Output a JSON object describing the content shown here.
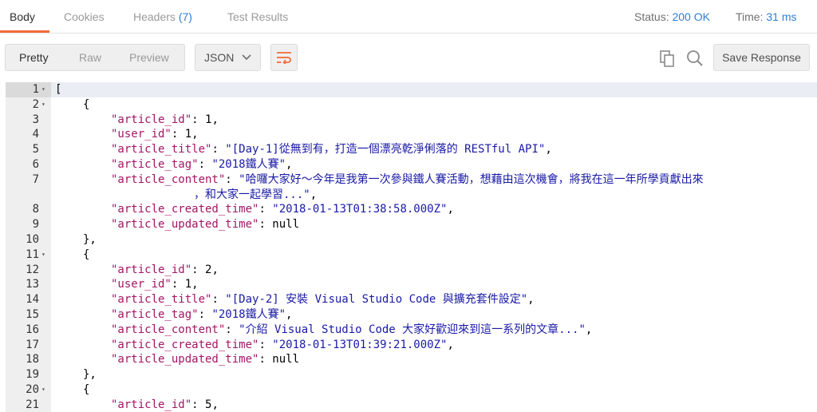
{
  "tabs": [
    {
      "label": "Body",
      "active": true
    },
    {
      "label": "Cookies"
    },
    {
      "label": "Headers",
      "count": "(7)"
    },
    {
      "label": "Test Results"
    }
  ],
  "status": {
    "status_label": "Status:",
    "status_value": "200 OK",
    "time_label": "Time:",
    "time_value": "31 ms"
  },
  "view_modes": [
    "Pretty",
    "Raw",
    "Preview"
  ],
  "format": "JSON",
  "save_label": "Save Response",
  "icons": {
    "wrap": "wrap-lines-icon",
    "copy": "copy-icon",
    "search": "search-icon",
    "chevron": "chevron-down-icon"
  },
  "colors": {
    "accent": "#f26b3a",
    "link": "#2d7ed9",
    "key": "#a31566",
    "string": "#1a1aa6"
  },
  "code_lines": [
    {
      "n": "1",
      "fold": true,
      "indent": 0,
      "p": "["
    },
    {
      "n": "2",
      "fold": true,
      "indent": 1,
      "p": "{"
    },
    {
      "n": "3",
      "indent": 2,
      "k": "\"article_id\"",
      "p": ": ",
      "v": "1",
      "e": ","
    },
    {
      "n": "4",
      "indent": 2,
      "k": "\"user_id\"",
      "p": ": ",
      "v": "1",
      "e": ","
    },
    {
      "n": "5",
      "indent": 2,
      "k": "\"article_title\"",
      "p": ": ",
      "s": "\"[Day-1]從無到有，打造一個漂亮乾淨俐落的 RESTful API\"",
      "e": ","
    },
    {
      "n": "6",
      "indent": 2,
      "k": "\"article_tag\"",
      "p": ": ",
      "s": "\"2018鐵人賽\"",
      "e": ","
    },
    {
      "n": "7",
      "indent": 2,
      "k": "\"article_content\"",
      "p": ": ",
      "s": "\"哈囉大家好～今年是我第一次參與鐵人賽活動，想藉由這次機會，將我在這一年所學貢獻出來",
      "s2": "，和大家一起學習...\"",
      "e": ","
    },
    {
      "n": "8",
      "indent": 2,
      "k": "\"article_created_time\"",
      "p": ": ",
      "s": "\"2018-01-13T01:38:58.000Z\"",
      "e": ","
    },
    {
      "n": "9",
      "indent": 2,
      "k": "\"article_updated_time\"",
      "p": ": ",
      "v": "null"
    },
    {
      "n": "10",
      "indent": 1,
      "p": "},"
    },
    {
      "n": "11",
      "fold": true,
      "indent": 1,
      "p": "{"
    },
    {
      "n": "12",
      "indent": 2,
      "k": "\"article_id\"",
      "p": ": ",
      "v": "2",
      "e": ","
    },
    {
      "n": "13",
      "indent": 2,
      "k": "\"user_id\"",
      "p": ": ",
      "v": "1",
      "e": ","
    },
    {
      "n": "14",
      "indent": 2,
      "k": "\"article_title\"",
      "p": ": ",
      "s": "\"[Day-2] 安裝 Visual Studio Code 與擴充套件設定\"",
      "e": ","
    },
    {
      "n": "15",
      "indent": 2,
      "k": "\"article_tag\"",
      "p": ": ",
      "s": "\"2018鐵人賽\"",
      "e": ","
    },
    {
      "n": "16",
      "indent": 2,
      "k": "\"article_content\"",
      "p": ": ",
      "s": "\"介紹 Visual Studio Code 大家好歡迎來到這一系列的文章...\"",
      "e": ","
    },
    {
      "n": "17",
      "indent": 2,
      "k": "\"article_created_time\"",
      "p": ": ",
      "s": "\"2018-01-13T01:39:21.000Z\"",
      "e": ","
    },
    {
      "n": "18",
      "indent": 2,
      "k": "\"article_updated_time\"",
      "p": ": ",
      "v": "null"
    },
    {
      "n": "19",
      "indent": 1,
      "p": "},"
    },
    {
      "n": "20",
      "fold": true,
      "indent": 1,
      "p": "{"
    },
    {
      "n": "21",
      "indent": 2,
      "k": "\"article_id\"",
      "p": ": ",
      "v": "5",
      "e": ","
    }
  ]
}
